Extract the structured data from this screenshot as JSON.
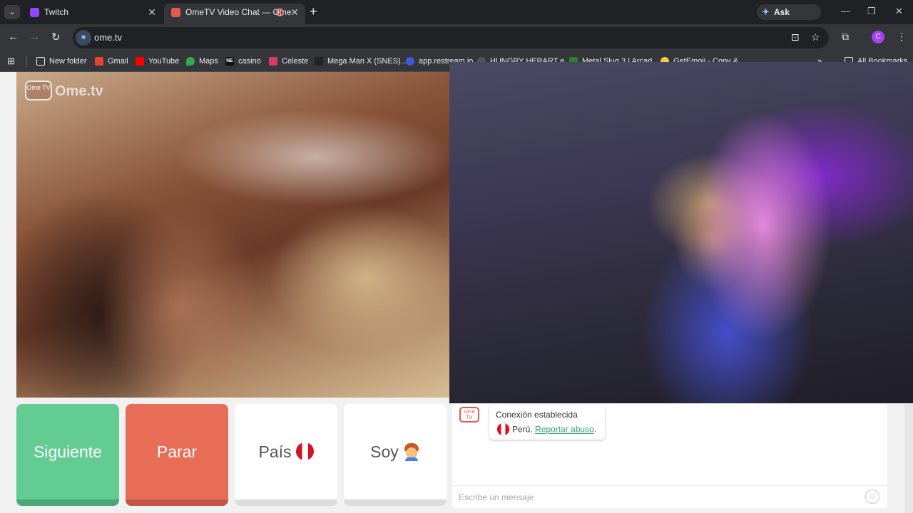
{
  "browser": {
    "tabs": [
      {
        "title": "Twitch",
        "active": false
      },
      {
        "title": "OmeTV Video Chat — Ome",
        "active": true
      }
    ],
    "gemini_label": "Ask Gemini",
    "url": "ome.tv",
    "profile_initial": "C",
    "bookmarks": [
      {
        "label": "New folder",
        "icon": "folder-icon"
      },
      {
        "label": "Gmail",
        "icon": "gmail-icon"
      },
      {
        "label": "YouTube",
        "icon": "youtube-icon"
      },
      {
        "label": "Maps",
        "icon": "maps-icon"
      },
      {
        "label": "casino",
        "icon": "ne-icon"
      },
      {
        "label": "Celeste",
        "icon": "celeste-icon"
      },
      {
        "label": "Mega Man X (SNES)...",
        "icon": "megaman-icon"
      },
      {
        "label": "app.restream.io",
        "icon": "restream-icon"
      },
      {
        "label": "HUNGRY HERART e...",
        "icon": "hungry-icon"
      },
      {
        "label": "Metal Slug 3 | Arcad...",
        "icon": "metalslug-icon"
      },
      {
        "label": "GetEmoji - Copy &...",
        "icon": "getemoji-icon"
      }
    ],
    "all_bookmarks_label": "All Bookmarks"
  },
  "page": {
    "logo": {
      "badge": "Ome TV",
      "word": "Ome.tv"
    },
    "buttons": {
      "next": "Siguiente",
      "stop": "Parar",
      "country": "País",
      "gender": "Soy"
    },
    "chat": {
      "logo": "Ome TV",
      "status": "Conexión establecida",
      "country": "Perú.",
      "report_link": "Reportar abuso",
      "report_suffix": ".",
      "input_placeholder": "Escribe un mensaje"
    }
  },
  "colors": {
    "next_button": "#62cc93",
    "stop_button": "#e86d57",
    "report_link": "#2e9e6a",
    "peru_red": "#d91023"
  }
}
